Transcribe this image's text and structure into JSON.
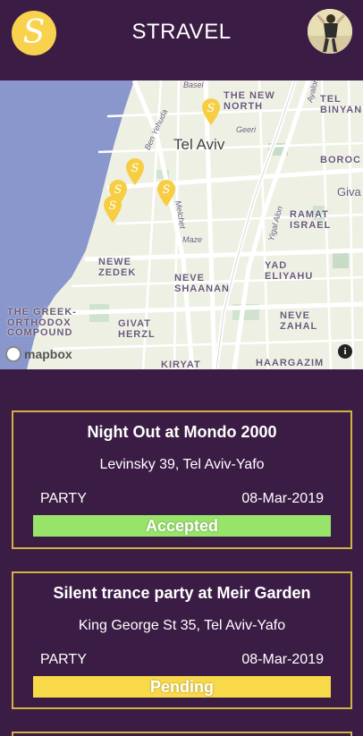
{
  "header": {
    "logo_letter": "S",
    "title": "STRAVEL"
  },
  "map": {
    "city": "Tel Aviv",
    "labels": [
      "THE NEW NORTH",
      "TEL BINYAN",
      "BOROC",
      "Giva",
      "RAMAT ISRAEL",
      "NEWE ZEDEK",
      "NEVE SHAANAN",
      "YAD ELIYAHU",
      "THE GREEK-ORTHODOX COMPOUND",
      "GIVAT HERZL",
      "NEVE ZAHAL",
      "KIRYAT",
      "HAARGAZIM"
    ],
    "streets": [
      "Basel",
      "Ayalon",
      "Ben Yehuda",
      "Geeri",
      "Yigal Alon",
      "Melchet",
      "Maze"
    ],
    "attribution": "mapbox",
    "info_glyph": "i"
  },
  "events": [
    {
      "title": "Night Out at Mondo 2000",
      "address": "Levinsky 39, Tel Aviv-Yafo",
      "type": "PARTY",
      "date": "08-Mar-2019",
      "status": "Accepted",
      "status_color": "#98e36a"
    },
    {
      "title": "Silent trance party at Meir Garden",
      "address": "King George St 35, Tel Aviv-Yafo",
      "type": "PARTY",
      "date": "08-Mar-2019",
      "status": "Pending",
      "status_color": "#f7d94a"
    }
  ],
  "colors": {
    "background": "#3b1c45",
    "accent": "#f8d24c",
    "card_border": "#d4b23f"
  }
}
